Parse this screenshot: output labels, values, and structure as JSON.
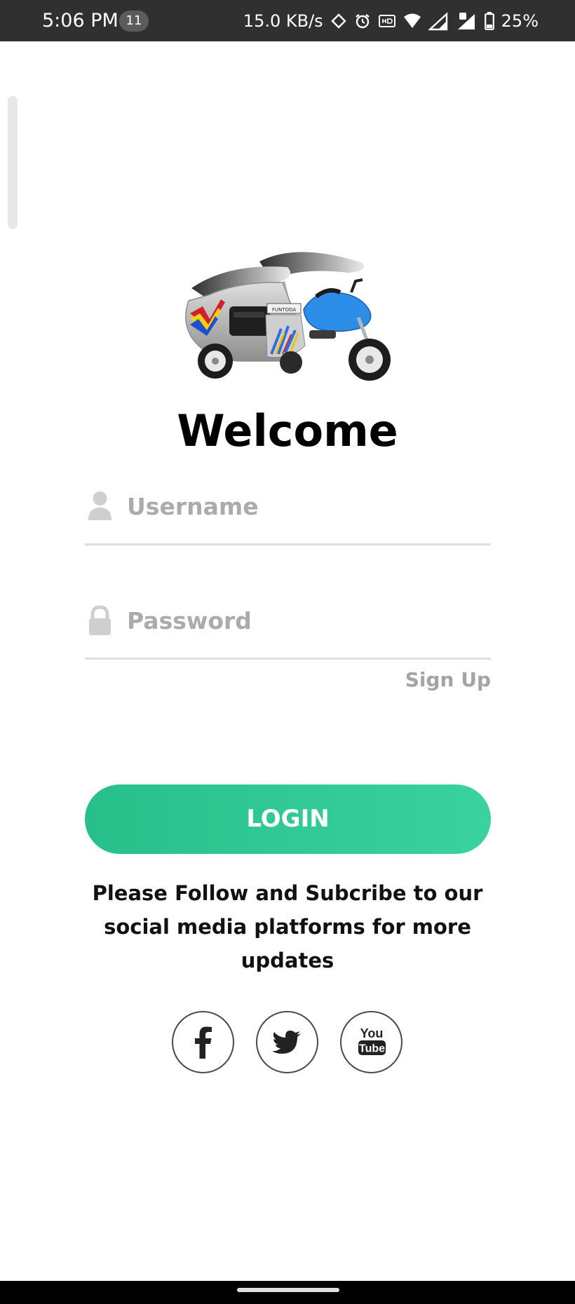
{
  "status_bar": {
    "time": "5:06 PM",
    "notification_count": "11",
    "network_speed": "15.0 KB/s",
    "battery": "25%",
    "icons": [
      "rotate-icon",
      "alarm-icon",
      "hd-icon",
      "wifi-icon",
      "signal-icon",
      "signal-icon",
      "battery-icon"
    ]
  },
  "login": {
    "title": "Welcome",
    "username_placeholder": "Username",
    "password_placeholder": "Password",
    "signup_label": "Sign Up",
    "login_label": "LOGIN"
  },
  "follow": {
    "text": "Please Follow and Subcribe to our social media platforms for more updates"
  },
  "social": {
    "youtube_top": "You",
    "youtube_bottom": "Tube",
    "items": [
      "facebook-icon",
      "twitter-icon",
      "youtube-icon"
    ]
  },
  "logo": {
    "sign_text": "FUNTODA"
  },
  "colors": {
    "accent": "#34cc98",
    "status_bar": "#303030",
    "placeholder": "#ababab",
    "divider": "#dedede"
  }
}
